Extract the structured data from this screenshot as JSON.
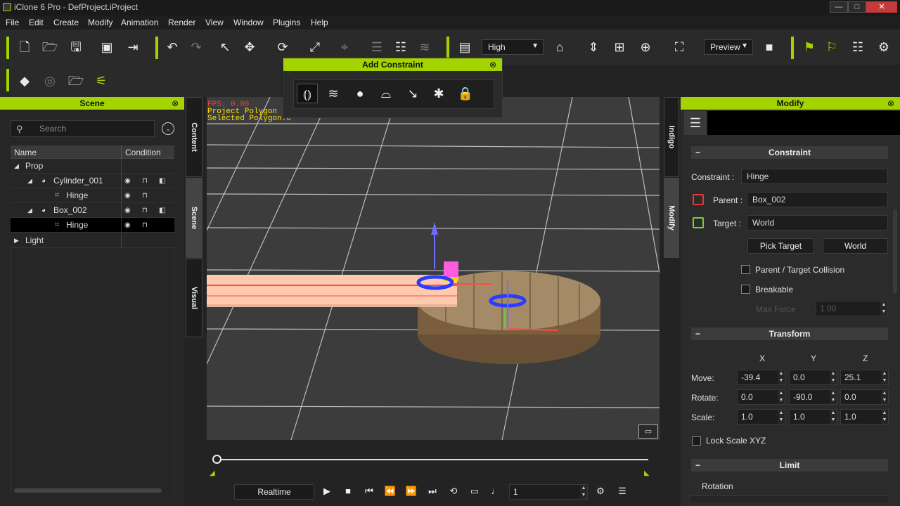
{
  "window": {
    "title": "iClone 6 Pro - DefProject.iProject",
    "min": "—",
    "max": "□",
    "close": "✕"
  },
  "menu": [
    "File",
    "Edit",
    "Create",
    "Modify",
    "Animation",
    "Render",
    "View",
    "Window",
    "Plugins",
    "Help"
  ],
  "toolbar": {
    "quality": "High",
    "preview": "Preview"
  },
  "constraint_popup": {
    "title": "Add Constraint",
    "close": "⊗",
    "icons": [
      "hinge-constraint-icon",
      "spring-constraint-icon",
      "point-constraint-icon",
      "cone-twist-constraint-icon",
      "slider-constraint-icon",
      "six-dof-constraint-icon",
      "lock-constraint-icon"
    ]
  },
  "scene_panel": {
    "title": "Scene",
    "close": "⊗",
    "search_placeholder": "Search",
    "columns": {
      "name": "Name",
      "condition": "Condition"
    },
    "rows": [
      {
        "label": "Prop",
        "arrow": "◢"
      },
      {
        "label": "Cylinder_001",
        "arrow": "◢"
      },
      {
        "label": "Hinge"
      },
      {
        "label": "Box_002",
        "arrow": "◢"
      },
      {
        "label": "Hinge"
      },
      {
        "label": "Light",
        "arrow": "▶"
      }
    ]
  },
  "side_tabs": {
    "left": [
      "Content",
      "Scene",
      "Visual"
    ],
    "right": [
      "Indigo",
      "Modify"
    ]
  },
  "viewport": {
    "fps": "FPS: 0.00",
    "hud_line2": "Project Polygon",
    "hud_line3": "Selected Polygon:0"
  },
  "modify_panel": {
    "title": "Modify",
    "close": "⊗",
    "constraint_section": "Constraint",
    "constraint_label": "Constraint :",
    "constraint_value": "Hinge",
    "parent_label": "Parent :",
    "parent_value": "Box_002",
    "target_label": "Target :",
    "target_value": "World",
    "pick_target": "Pick Target",
    "world_button": "World",
    "collision_label": "Parent / Target Collision",
    "breakable_label": "Breakable",
    "max_force_label": "Max Force",
    "max_force_value": "1.00",
    "transform_section": "Transform",
    "axes": [
      "X",
      "Y",
      "Z"
    ],
    "move_label": "Move:",
    "move": [
      "-39.4",
      "0.0",
      "25.1"
    ],
    "rotate_label": "Rotate:",
    "rotate": [
      "0.0",
      "-90.0",
      "0.0"
    ],
    "scale_label": "Scale:",
    "scale": [
      "1.0",
      "1.0",
      "1.0"
    ],
    "lock_scale": "Lock Scale XYZ",
    "limit_section": "Limit",
    "rotation_label": "Rotation"
  },
  "timeline": {
    "mode": "Realtime",
    "frame": "1",
    "progress": 0.0
  },
  "colors": {
    "accent": "#a3d300",
    "background": "#232323",
    "viewport": "#3c3c3c"
  }
}
